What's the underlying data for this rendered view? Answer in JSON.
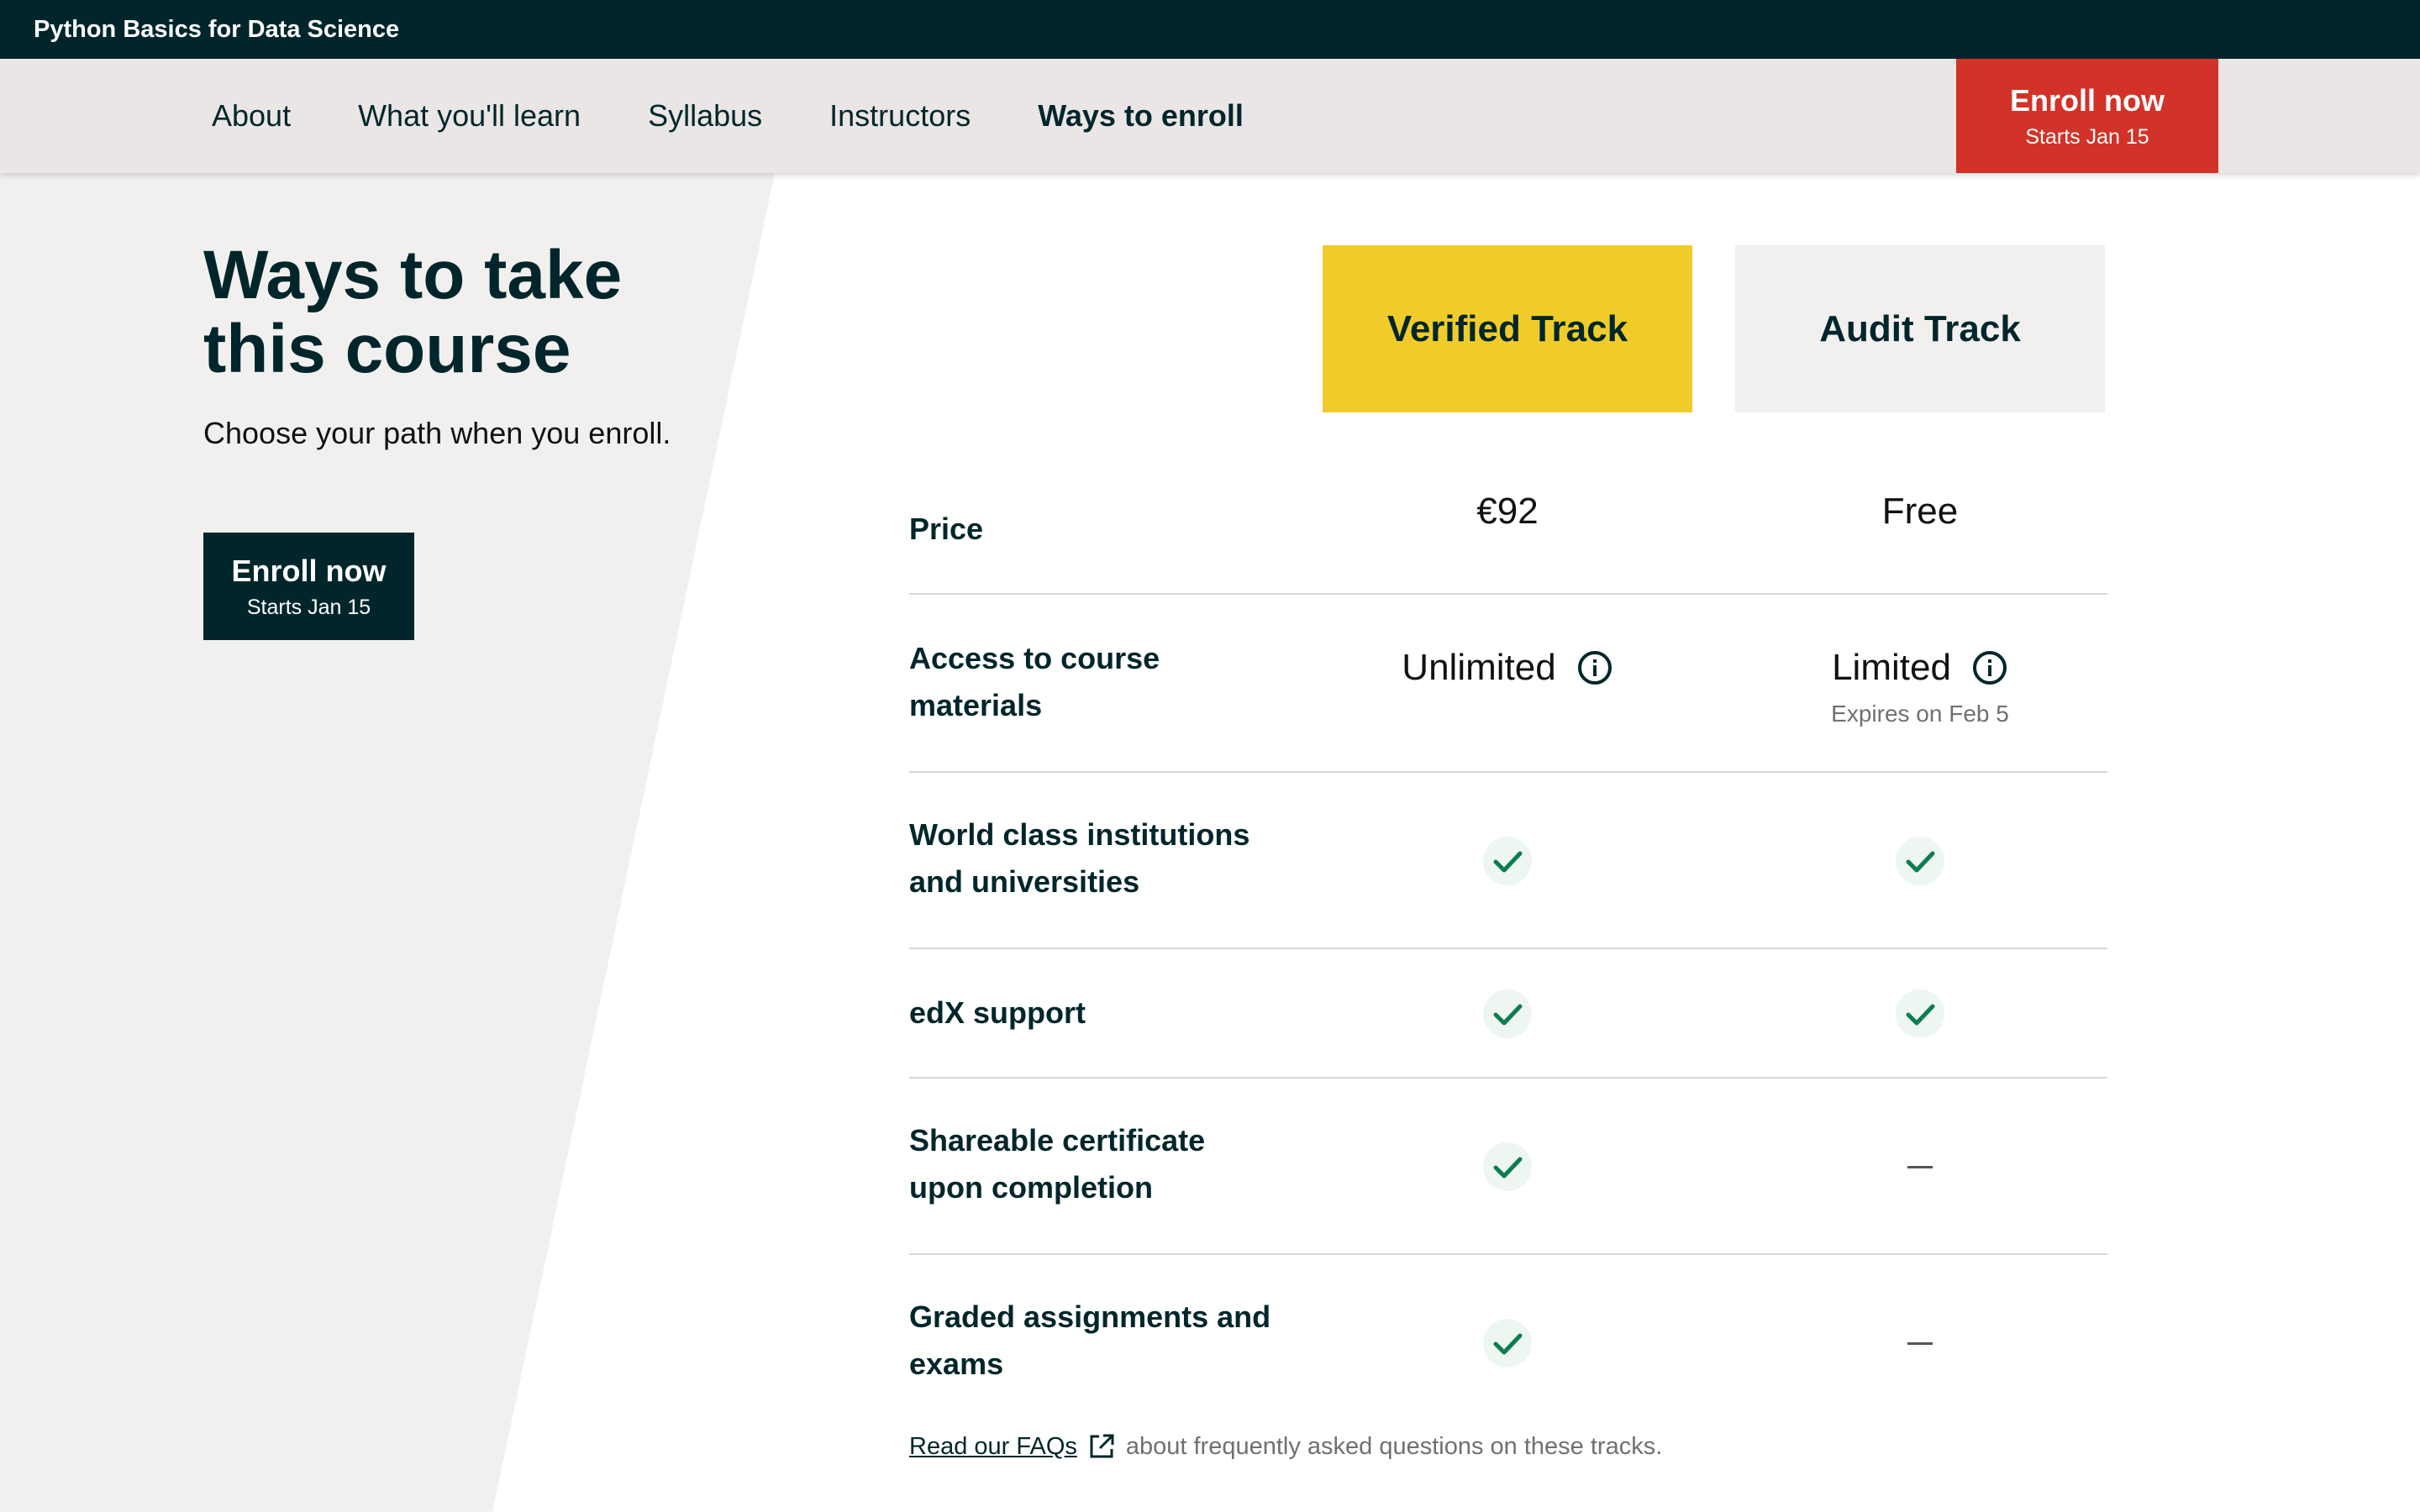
{
  "topbar": {
    "course_title": "Python Basics for Data Science"
  },
  "nav": {
    "links": [
      "About",
      "What you'll learn",
      "Syllabus",
      "Instructors",
      "Ways to enroll"
    ],
    "active_index": 4,
    "enroll": {
      "label": "Enroll now",
      "sub": "Starts Jan 15"
    }
  },
  "intro": {
    "title_line1": "Ways to take",
    "title_line2": "this course",
    "description": "Choose your path when you enroll.",
    "enroll": {
      "label": "Enroll now",
      "sub": "Starts Jan 15"
    }
  },
  "tracks": {
    "verified": {
      "name": "Verified Track",
      "color": "#f0cc2b"
    },
    "audit": {
      "name": "Audit Track",
      "color": "#f2f0ef"
    }
  },
  "rows": {
    "price": {
      "label": "Price",
      "verified": "€92",
      "audit": "Free"
    },
    "access": {
      "label_line1": "Access to course",
      "label_line2": "materials",
      "verified": "Unlimited",
      "audit": "Limited",
      "audit_sub": "Expires on Feb 5"
    },
    "institutions": {
      "label_line1": "World class institutions",
      "label_line2": "and universities",
      "verified": "check",
      "audit": "check"
    },
    "support": {
      "label": "edX support",
      "verified": "check",
      "audit": "check"
    },
    "certificate": {
      "label_line1": "Shareable certificate",
      "label_line2": "upon completion",
      "verified": "check",
      "audit": "dash"
    },
    "graded": {
      "label_line1": "Graded assignments and",
      "label_line2": "exams",
      "verified": "check",
      "audit": "dash"
    }
  },
  "faq": {
    "link_text": "Read our FAQs",
    "rest_text": "about frequently asked questions on these tracks."
  },
  "colors": {
    "dark": "#00262b",
    "enroll_red": "#d23228",
    "check_green": "#0d7d4d",
    "nav_bg": "#eae6e5",
    "panel_bg": "#f2f0ef"
  }
}
